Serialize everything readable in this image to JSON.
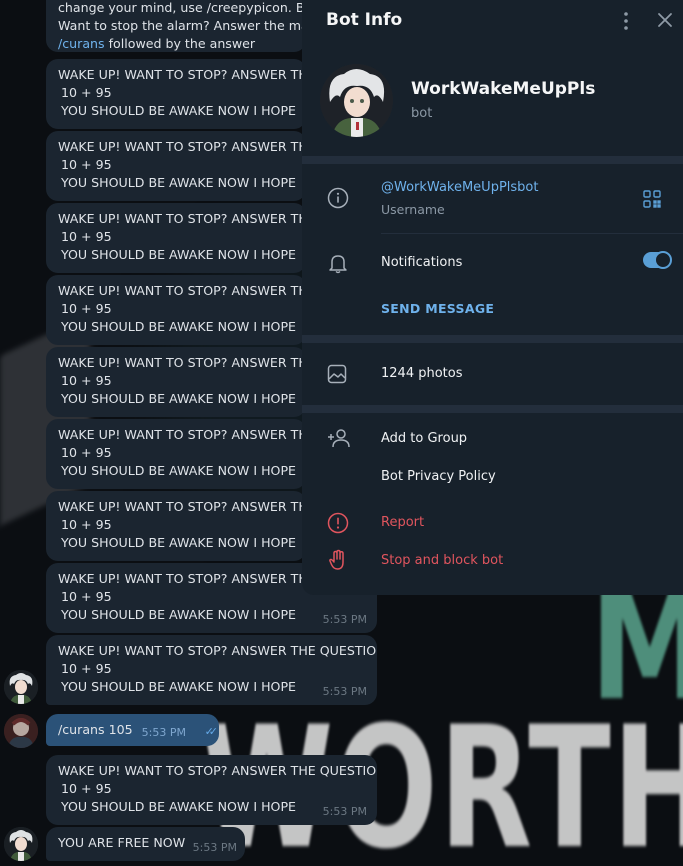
{
  "chat": {
    "top_partial": {
      "line1": "change your mind, use /creepypicon. By d",
      "line2": " Want to stop the alarm? Answer the mat",
      "line3_cmd": "/curans",
      "line3_rest": " followed by the answer"
    },
    "alarm_messages": [
      {
        "line1": "WAKE UP! WANT TO STOP? ANSWER THE",
        "line2": "10 + 95",
        "line3": "YOU SHOULD BE AWAKE NOW I HOPE",
        "time": ""
      },
      {
        "line1": "WAKE UP! WANT TO STOP? ANSWER THE",
        "line2": "10 + 95",
        "line3": "YOU SHOULD BE AWAKE NOW I HOPE",
        "time": ""
      },
      {
        "line1": "WAKE UP! WANT TO STOP? ANSWER THE",
        "line2": "10 + 95",
        "line3": "YOU SHOULD BE AWAKE NOW I HOPE",
        "time": ""
      },
      {
        "line1": "WAKE UP! WANT TO STOP? ANSWER THE",
        "line2": "10 + 95",
        "line3": "YOU SHOULD BE AWAKE NOW I HOPE",
        "time": ""
      },
      {
        "line1": "WAKE UP! WANT TO STOP? ANSWER THE",
        "line2": "10 + 95",
        "line3": "YOU SHOULD BE AWAKE NOW I HOPE",
        "time": ""
      },
      {
        "line1": "WAKE UP! WANT TO STOP? ANSWER THE",
        "line2": "10 + 95",
        "line3": "YOU SHOULD BE AWAKE NOW I HOPE",
        "time": ""
      },
      {
        "line1": "WAKE UP! WANT TO STOP? ANSWER THE",
        "line2": "10 + 95",
        "line3": "YOU SHOULD BE AWAKE NOW I HOPE",
        "time": ""
      },
      {
        "line1": "WAKE UP! WANT TO STOP? ANSWER THE",
        "line2": "10 + 95",
        "line3": "YOU SHOULD BE AWAKE NOW I HOPE",
        "time": "5:53 PM"
      },
      {
        "line1": "WAKE UP! WANT TO STOP? ANSWER THE QUESTION",
        "line2": "10 + 95",
        "line3": "YOU SHOULD BE AWAKE NOW I HOPE",
        "time": "5:53 PM"
      }
    ],
    "outgoing": {
      "text": "/curans 105",
      "time": "5:53 PM"
    },
    "final_alarm": {
      "line1": "WAKE UP! WANT TO STOP? ANSWER THE QUESTION",
      "line2": "10 + 95",
      "line3": "YOU SHOULD BE AWAKE NOW I HOPE",
      "time": "5:53 PM"
    },
    "free": {
      "text": "YOU ARE FREE NOW",
      "time": "5:53 PM"
    },
    "background_text": {
      "big": "WORTHL",
      "corner": "M"
    }
  },
  "panel": {
    "title": "Bot Info",
    "name": "WorkWakeMeUpPls",
    "subtitle": "bot",
    "username": "@WorkWakeMeUpPlsbot",
    "username_label": "Username",
    "notifications_label": "Notifications",
    "notifications_on": true,
    "send_message": "SEND MESSAGE",
    "photos": "1244 photos",
    "add_to_group": "Add to Group",
    "privacy_policy": "Bot Privacy Policy",
    "report": "Report",
    "stop_block": "Stop and block bot"
  },
  "colors": {
    "accent": "#6fb2ec",
    "danger": "#e0555e",
    "panel_bg": "#17212b",
    "bubble_in": "#1b2530",
    "bubble_out": "#2b5278"
  }
}
